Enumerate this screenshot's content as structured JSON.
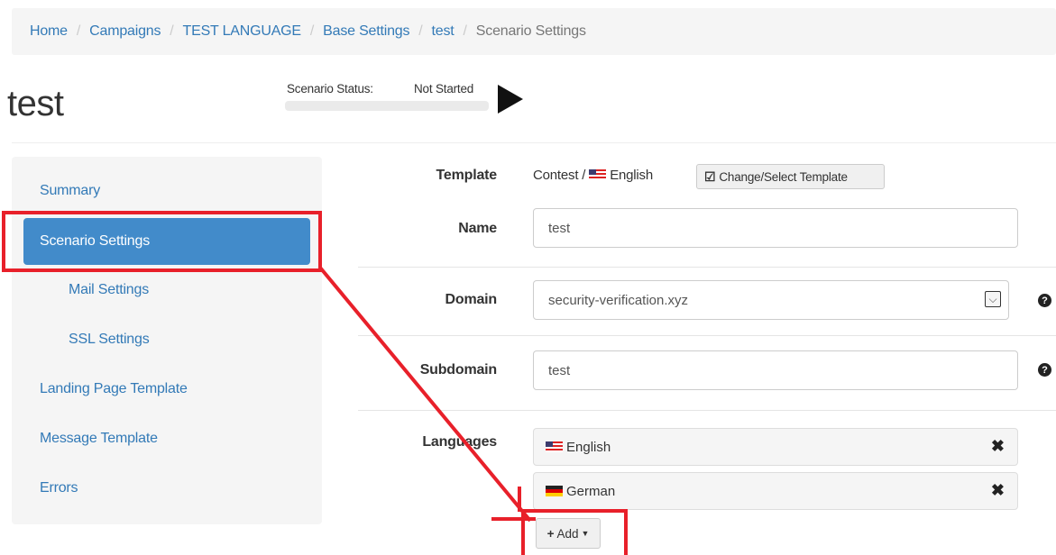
{
  "breadcrumb": {
    "items": [
      "Home",
      "Campaigns",
      "TEST LANGUAGE",
      "Base Settings",
      "test"
    ],
    "active": "Scenario Settings",
    "separator": "/"
  },
  "header": {
    "title": "test",
    "status_label": "Scenario Status:",
    "status_value": "Not Started",
    "status_progress": 0
  },
  "sidebar": {
    "items": [
      {
        "label": "Summary"
      },
      {
        "label": "Scenario Settings",
        "active": true
      },
      {
        "label": "Mail Settings",
        "sub": true
      },
      {
        "label": "SSL Settings",
        "sub": true
      },
      {
        "label": "Landing Page Template"
      },
      {
        "label": "Message Template"
      },
      {
        "label": "Errors"
      }
    ]
  },
  "form": {
    "template": {
      "label": "Template",
      "value_prefix": "Contest /",
      "value_language": "English",
      "button_label": "Change/Select Template"
    },
    "name": {
      "label": "Name",
      "value": "test"
    },
    "domain": {
      "label": "Domain",
      "value": "security-verification.xyz"
    },
    "subdomain": {
      "label": "Subdomain",
      "value": "test"
    },
    "languages": {
      "label": "Languages",
      "items": [
        {
          "label": "English",
          "flag": "us-flag-icon"
        },
        {
          "label": "German",
          "flag": "de-flag-icon"
        }
      ],
      "add_label": "Add"
    }
  },
  "colors": {
    "link": "#337ab7",
    "active_nav": "#428bca",
    "annotation": "#e8202a"
  }
}
